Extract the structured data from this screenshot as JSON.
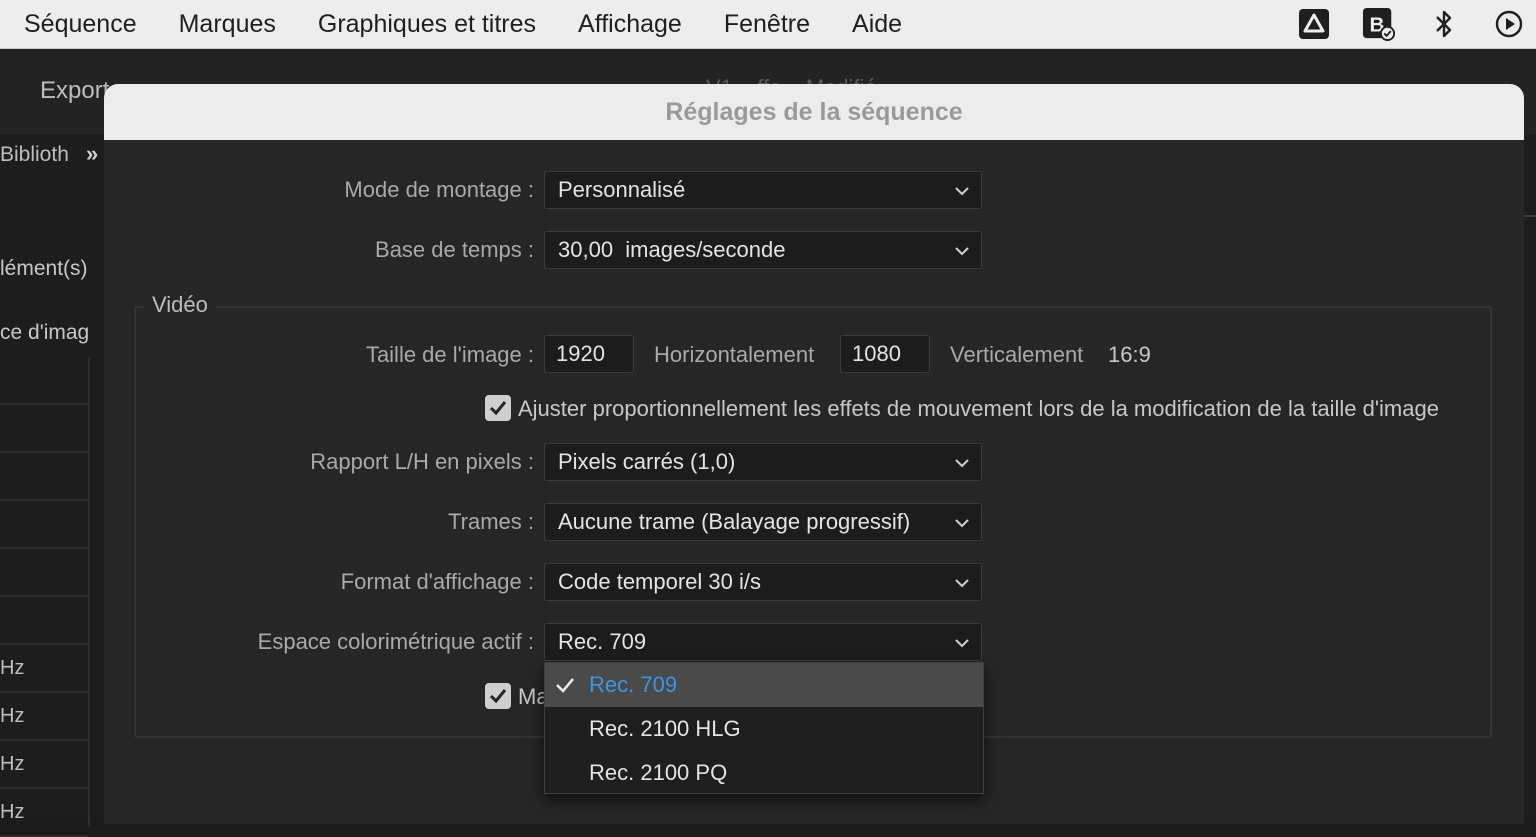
{
  "menubar": {
    "items": [
      "Séquence",
      "Marques",
      "Graphiques et titres",
      "Affichage",
      "Fenêtre",
      "Aide"
    ],
    "tray_icons": [
      "google-drive-icon",
      "backup-status-icon",
      "bluetooth-icon",
      "play-circle-icon"
    ]
  },
  "background": {
    "export_label": "Export",
    "ghost_header": "V1 ...ffe... Modifié",
    "library_label": "Biblioth",
    "elements_label": "lément(s)",
    "image_label": "ce d'imag",
    "rows": [
      "",
      "",
      "",
      "",
      "",
      "",
      "Hz",
      "Hz",
      "Hz",
      "Hz"
    ]
  },
  "dialog": {
    "title": "Réglages de la séquence",
    "editing_mode": {
      "label": "Mode de montage :",
      "value": "Personnalisé"
    },
    "timebase": {
      "label": "Base de temps :",
      "value": "30,00  images/seconde"
    },
    "video_group_title": "Vidéo",
    "frame_size": {
      "label": "Taille de l'image :",
      "width": "1920",
      "horizontal_label": "Horizontalement",
      "height": "1080",
      "vertical_label": "Verticalement",
      "aspect": "16:9"
    },
    "scale_effects_checkbox": {
      "checked": true,
      "label": "Ajuster proportionnellement les effets de mouvement lors de la modification de la taille d'image"
    },
    "pixel_aspect": {
      "label": "Rapport L/H en pixels :",
      "value": "Pixels carrés (1,0)"
    },
    "fields": {
      "label": "Trames :",
      "value": "Aucune trame (Balayage progressif)"
    },
    "display_format": {
      "label": "Format d'affichage :",
      "value": "Code temporel 30 i/s"
    },
    "color_space": {
      "label": "Espace colorimétrique actif :",
      "value": "Rec. 709",
      "options": [
        "Rec. 709",
        "Rec. 2100 HLG",
        "Rec. 2100 PQ"
      ],
      "selected_index": 0
    },
    "second_checkbox": {
      "checked": true,
      "label_visible": "Ma"
    }
  },
  "colors": {
    "menubar_bg": "#ededed",
    "dialog_bg": "#262626",
    "accent_blue": "#3b95e0",
    "selected_row_bg": "#4a4a4a"
  }
}
